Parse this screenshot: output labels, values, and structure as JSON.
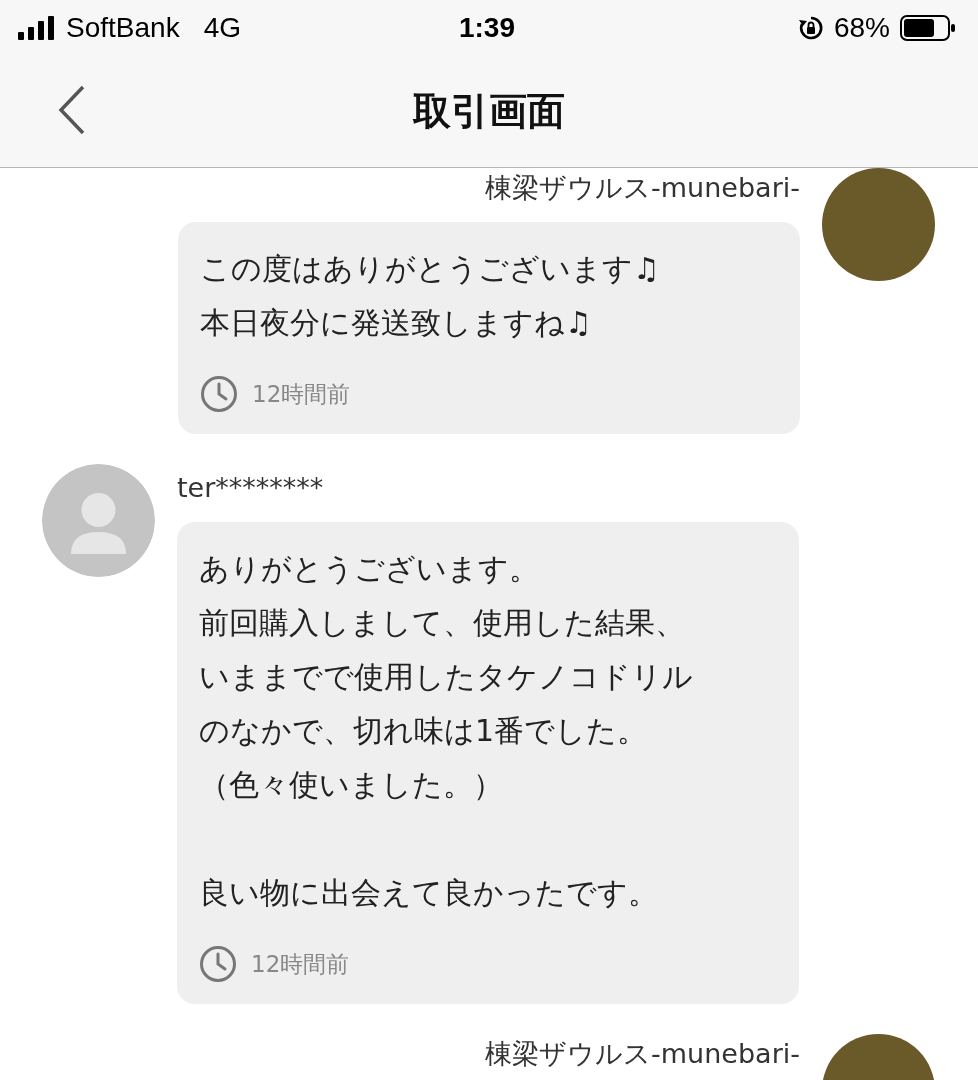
{
  "status_bar": {
    "carrier": "SoftBank",
    "network": "4G",
    "time": "1:39",
    "battery": "68%"
  },
  "nav": {
    "title": "取引画面"
  },
  "messages": [
    {
      "kind": "outgoing",
      "sender": "棟梁ザウルス-munebari-",
      "paragraphs": [
        [
          "この度はありがとうございます♫",
          "本日夜分に発送致しますね♫"
        ]
      ],
      "time": "12時間前"
    },
    {
      "kind": "incoming",
      "sender": "ter********",
      "paragraphs": [
        [
          "ありがとうございます。",
          "前回購入しまして、使用した結果、",
          "いままでで使用したタケノコドリル",
          "のなかで、切れ味は1番でした。",
          "（色々使いました。）"
        ],
        [
          "良い物に出会えて良かったです。"
        ]
      ],
      "time": "12時間前"
    },
    {
      "kind": "outgoing",
      "sender": "棟梁ザウルス-munebari-"
    }
  ]
}
